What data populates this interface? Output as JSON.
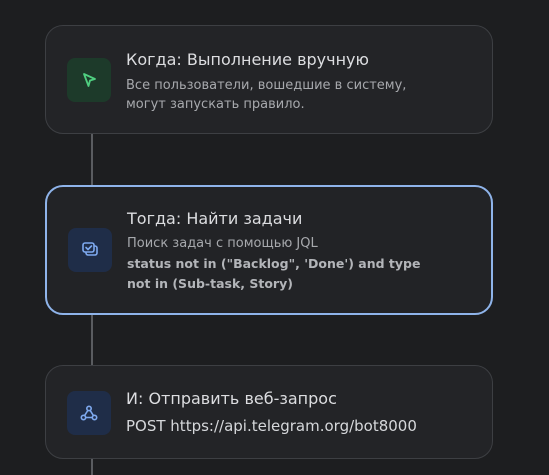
{
  "flow": {
    "trigger": {
      "title": "Когда: Выполнение вручную",
      "description_line1": "Все пользователи, вошедшие в систему,",
      "description_line2": "могут запускать правило.",
      "icon": "cursor-icon",
      "accent": "#4fcf80"
    },
    "action_find": {
      "title": "Тогда: Найти задачи",
      "description": "Поиск задач с помощью JQL",
      "jql_line1": "status not in (\"Backlog\", 'Done') and type",
      "jql_line2": "not in (Sub-task, Story)",
      "icon": "issues-icon",
      "accent": "#7ea9ef"
    },
    "action_webhook": {
      "title": "И: Отправить веб-запрос",
      "request": "POST https://api.telegram.org/bot8000",
      "icon": "webhook-icon",
      "accent": "#7ea9ef"
    }
  }
}
